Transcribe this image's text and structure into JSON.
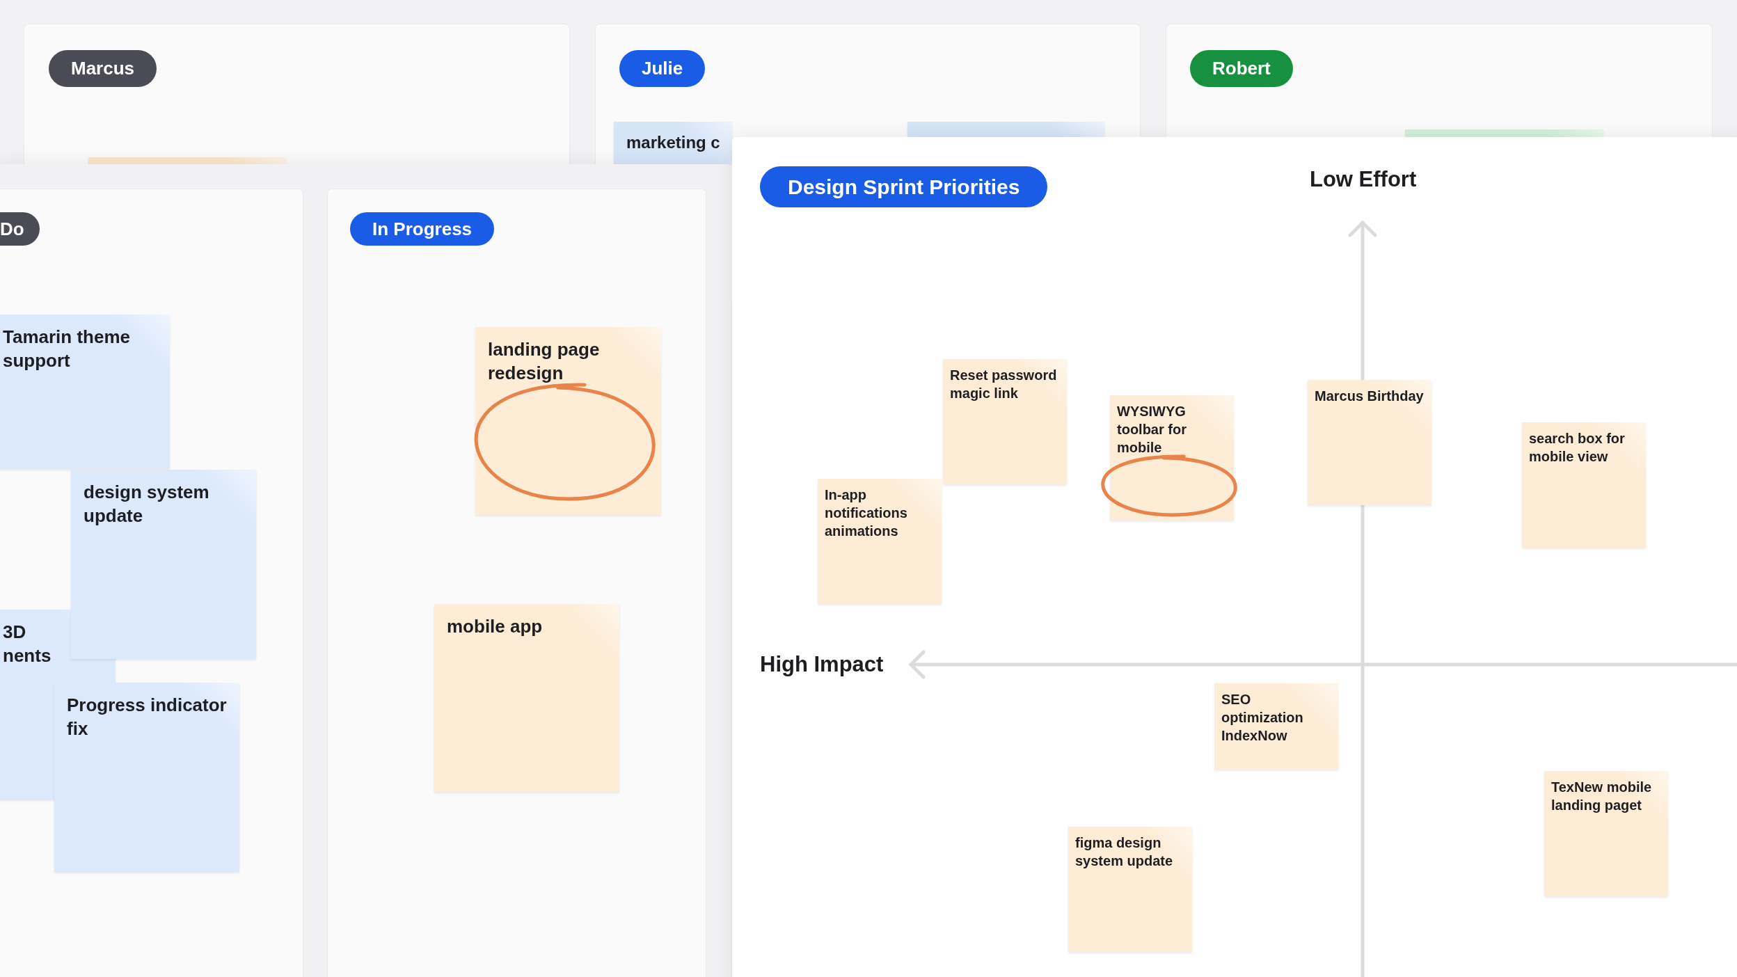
{
  "people_boards": [
    {
      "name": "Marcus",
      "color": "#4b4b55",
      "notes": [
        {
          "color": "#fbe6cc"
        }
      ]
    },
    {
      "name": "Julie",
      "color": "#1a5ce6",
      "notes": [
        {
          "text": "marketing c",
          "color": "#d6e4f8"
        },
        {
          "color": "#d6e4f8"
        }
      ]
    },
    {
      "name": "Robert",
      "color": "#17903f",
      "notes": [
        {
          "color": "#d3efda"
        }
      ]
    }
  ],
  "kanban": {
    "columns": [
      {
        "title": "Do",
        "color": "#4b4b55",
        "notes": [
          {
            "text": "Tamarin theme support",
            "color": "#dce9fd"
          },
          {
            "text": "3D nents",
            "color": "#dce9fd"
          },
          {
            "text": "design system update",
            "color": "#dce9fd"
          },
          {
            "text": "Progress indicator fix",
            "color": "#dce9fd"
          }
        ]
      },
      {
        "title": "In Progress",
        "color": "#1a5ce6",
        "notes": [
          {
            "text": "landing page redesign",
            "color": "#fdecd6",
            "circled": true
          },
          {
            "text": "mobile app",
            "color": "#fdecd6",
            "circled": false
          }
        ]
      }
    ]
  },
  "priorities": {
    "title": "Design Sprint Priorities",
    "y_axis_label": "Low Effort",
    "x_axis_label": "High Impact",
    "notes": [
      {
        "text": "Reset password magic link",
        "circled": false
      },
      {
        "text": "In-app notifications animations",
        "circled": false
      },
      {
        "text": "WYSIWYG toolbar for mobile",
        "circled": true
      },
      {
        "text": "Marcus Birthday",
        "circled": false
      },
      {
        "text": "search box for mobile view",
        "circled": false
      },
      {
        "text": "SEO optimization IndexNow",
        "circled": false
      },
      {
        "text": "figma design system update",
        "circled": false
      },
      {
        "text": "TexNew mobile landing paget",
        "circled": false
      }
    ]
  }
}
